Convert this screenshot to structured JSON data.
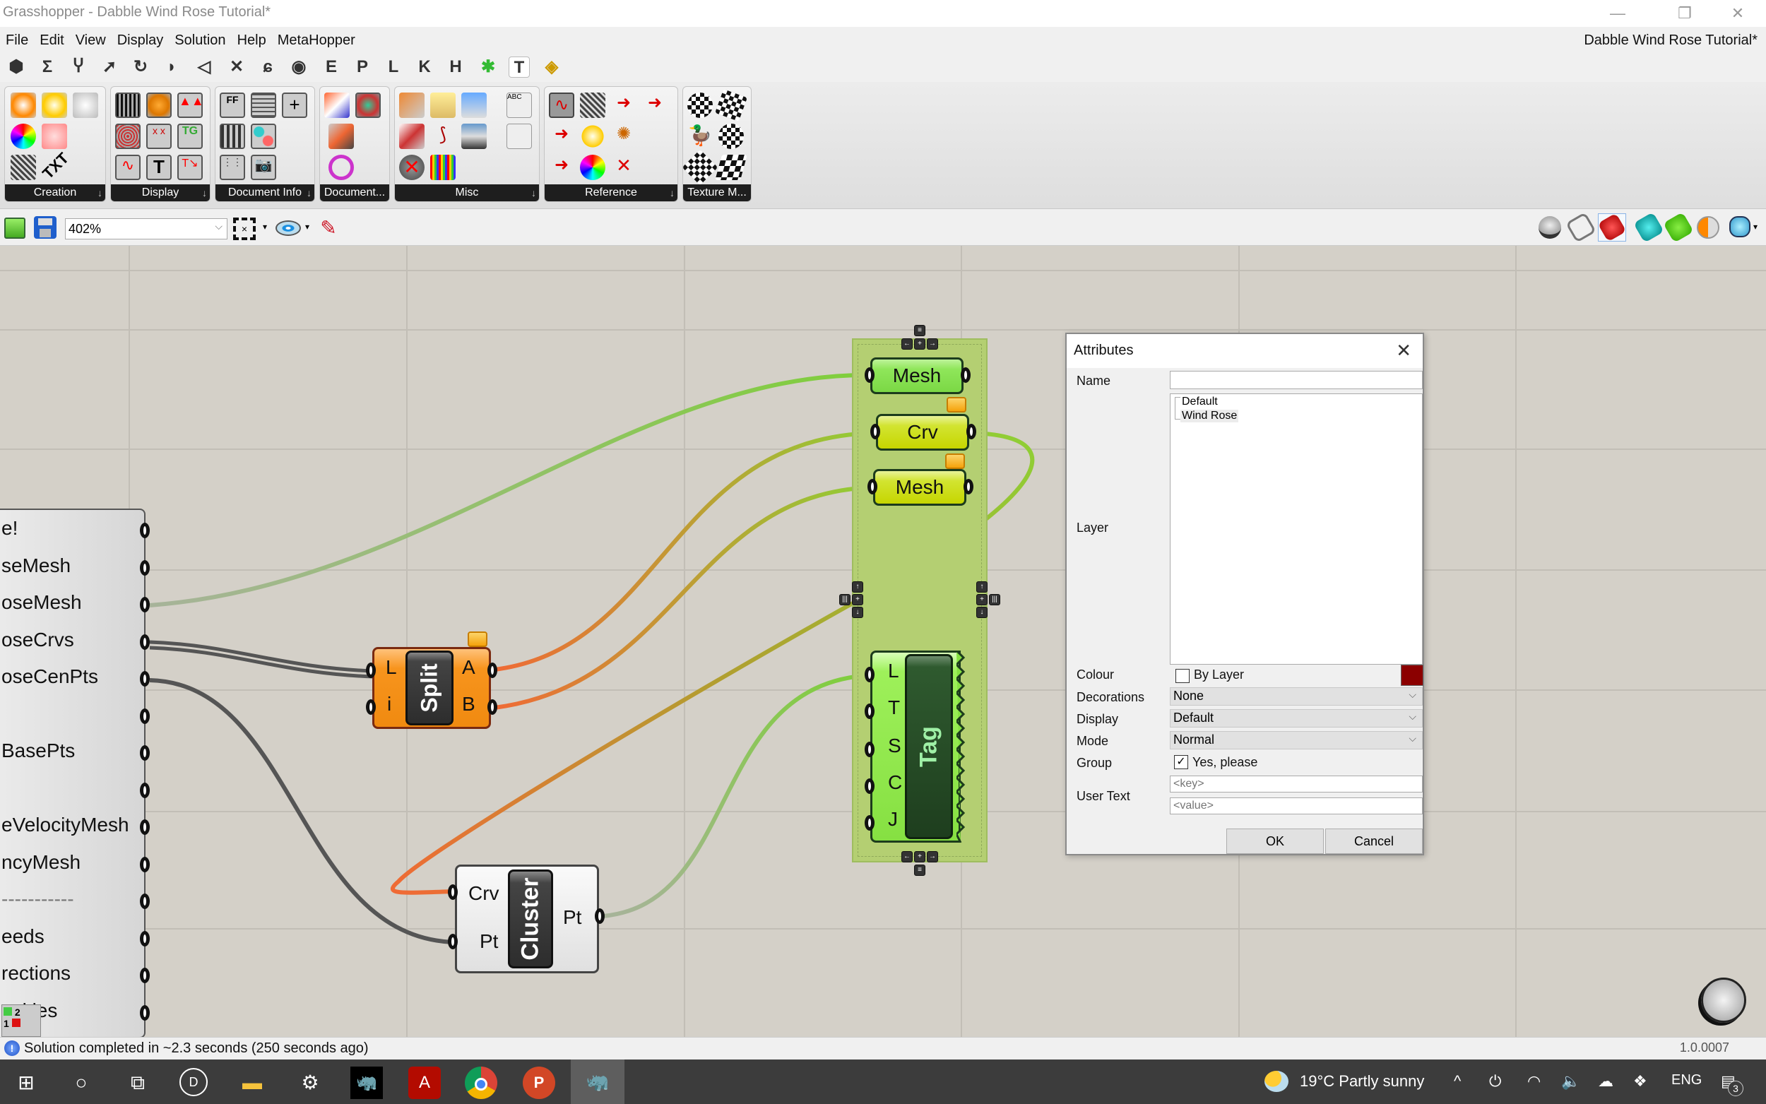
{
  "window": {
    "title": "Grasshopper - Dabble Wind Rose Tutorial*",
    "document_title": "Dabble Wind Rose Tutorial*",
    "controls": {
      "minimize": "—",
      "restore": "❐",
      "close": "✕"
    }
  },
  "menu": {
    "items": [
      "File",
      "Edit",
      "View",
      "Display",
      "Solution",
      "Help",
      "MetaHopper"
    ]
  },
  "tabstrip": {
    "icons": [
      {
        "name": "params-tab-icon",
        "glyph": "⬢"
      },
      {
        "name": "maths-tab-icon",
        "glyph": "Σ"
      },
      {
        "name": "sets-tab-icon",
        "glyph": "Ⴤ"
      },
      {
        "name": "vector-tab-icon",
        "glyph": "➚"
      },
      {
        "name": "curve-tab-icon",
        "glyph": "↻"
      },
      {
        "name": "surface-tab-icon",
        "glyph": "◗"
      },
      {
        "name": "mesh-tab-icon",
        "glyph": "◁"
      },
      {
        "name": "intersect-tab-icon",
        "glyph": "✕"
      },
      {
        "name": "transform-tab-icon",
        "glyph": "ɕ"
      },
      {
        "name": "display-tab-icon",
        "glyph": "◉"
      },
      {
        "name": "e-tab-icon",
        "glyph": "E"
      },
      {
        "name": "p-tab-icon",
        "glyph": "P"
      },
      {
        "name": "l-tab-icon",
        "glyph": "L"
      },
      {
        "name": "k-tab-icon",
        "glyph": "K"
      },
      {
        "name": "h-tab-icon",
        "glyph": "H"
      },
      {
        "name": "grasshopper-tab-icon",
        "glyph": "✱"
      },
      {
        "name": "human-tab-icon",
        "glyph": "T"
      },
      {
        "name": "striped-tab-icon",
        "glyph": "◈"
      }
    ],
    "active_index": 16
  },
  "ribbon": {
    "panels": [
      {
        "label": "Creation",
        "has_arrow": true
      },
      {
        "label": "Display",
        "has_arrow": true
      },
      {
        "label": "Document Info",
        "has_arrow": true
      },
      {
        "label": "Document...",
        "has_arrow": false
      },
      {
        "label": "Misc",
        "has_arrow": true
      },
      {
        "label": "Reference",
        "has_arrow": true
      },
      {
        "label": "Texture M...",
        "has_arrow": false
      }
    ],
    "panel_arrow": "↓"
  },
  "canvas_toolbar": {
    "zoom": "402%",
    "zoom_chevron": "⌵"
  },
  "canvas": {
    "big_component": {
      "outputs": [
        "e!",
        "seMesh",
        "oseMesh",
        "oseCrvs",
        "oseCenPts",
        "",
        "BasePts",
        "",
        "eVelocityMesh",
        "ncyMesh",
        "-----------",
        "eeds",
        "rections",
        "ocities"
      ]
    },
    "split": {
      "name": "Split",
      "inputs": [
        "L",
        "i"
      ],
      "outputs": [
        "A",
        "B"
      ]
    },
    "cluster": {
      "name": "Cluster",
      "inputs": [
        "Crv",
        "Pt"
      ],
      "outputs": [
        "Pt"
      ]
    },
    "group_params": [
      {
        "label": "Mesh",
        "style": "green"
      },
      {
        "label": "Crv",
        "style": "yellow"
      },
      {
        "label": "Mesh",
        "style": "yellow"
      }
    ],
    "tag": {
      "name": "Tag",
      "inputs": [
        "L",
        "T",
        "S",
        "C",
        "J"
      ]
    },
    "group_color": "#b4cf72"
  },
  "dialog": {
    "title": "Attributes",
    "close": "✕",
    "name_label": "Name",
    "name_value": "",
    "layer_label": "Layer",
    "layers": [
      "Default",
      "Wind Rose"
    ],
    "selected_layer": "Wind Rose",
    "colour_label": "Colour",
    "by_layer_label": "By Layer",
    "by_layer_checked": false,
    "colour_swatch": "#8b0000",
    "decorations_label": "Decorations",
    "decorations_value": "None",
    "display_label": "Display",
    "display_value": "Default",
    "mode_label": "Mode",
    "mode_value": "Normal",
    "group_label": "Group",
    "group_check_label": "Yes, please",
    "group_checked": true,
    "user_text_label": "User Text",
    "key_placeholder": "<key>",
    "value_placeholder": "<value>",
    "ok": "OK",
    "cancel": "Cancel",
    "chevron": "⌵"
  },
  "status": {
    "message": "Solution completed in ~2.3 seconds (250 seconds ago)",
    "version": "1.0.0007",
    "info_glyph": "!"
  },
  "taskbar": {
    "apps": [
      {
        "name": "windows-start-icon",
        "glyph": "⊞"
      },
      {
        "name": "cortana-search-icon",
        "glyph": "○"
      },
      {
        "name": "task-view-icon",
        "glyph": "⧉"
      },
      {
        "name": "dell-icon",
        "glyph": "D"
      },
      {
        "name": "file-explorer-icon",
        "glyph": "▬"
      },
      {
        "name": "settings-icon",
        "glyph": "⚙"
      },
      {
        "name": "rhino-icon",
        "glyph": "🦏"
      },
      {
        "name": "acrobat-icon",
        "glyph": "A"
      },
      {
        "name": "chrome-icon",
        "glyph": "◎"
      },
      {
        "name": "powerpoint-icon",
        "glyph": "P"
      },
      {
        "name": "rhino-active-icon",
        "glyph": "🦏"
      }
    ],
    "weather": "19°C  Partly sunny",
    "language": "ENG",
    "notifications": "3"
  }
}
